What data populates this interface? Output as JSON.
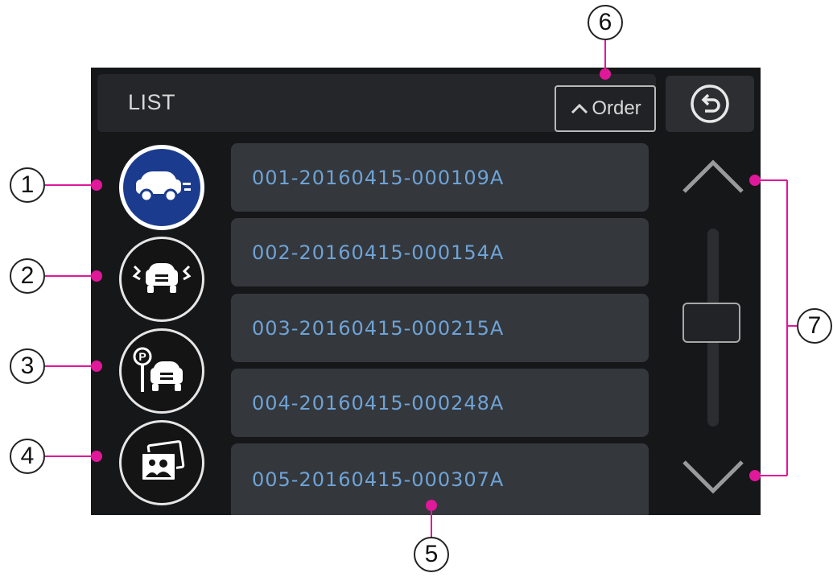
{
  "header": {
    "title": "LIST",
    "order_label": "Order"
  },
  "filters": [
    {
      "name": "driving-recordings",
      "icon": "car-driving-icon",
      "active": true
    },
    {
      "name": "impact-recordings",
      "icon": "car-impact-icon",
      "active": false
    },
    {
      "name": "parking-recordings",
      "icon": "car-parking-icon",
      "active": false
    },
    {
      "name": "photos",
      "icon": "photo-album-icon",
      "active": false
    }
  ],
  "list": {
    "items": [
      "001-20160415-000109A",
      "002-20160415-000154A",
      "003-20160415-000215A",
      "004-20160415-000248A",
      "005-20160415-000307A"
    ]
  },
  "callouts": {
    "c1": "1",
    "c2": "2",
    "c3": "3",
    "c4": "4",
    "c5": "5",
    "c6": "6",
    "c7": "7"
  },
  "colors": {
    "background": "#161719",
    "item_background": "#34373c",
    "item_text": "#6ea3d6",
    "active_filter": "#1b3c8e",
    "callout_line": "#e0189a"
  }
}
